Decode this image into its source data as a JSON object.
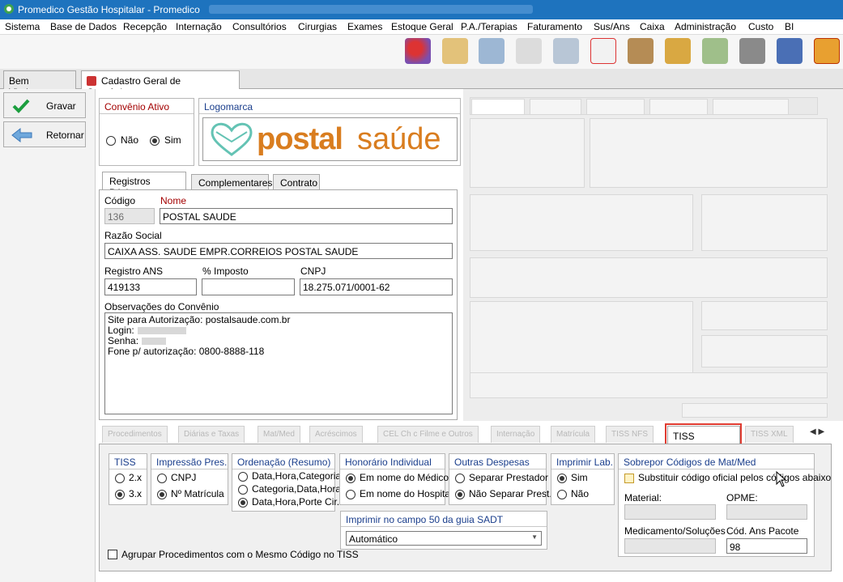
{
  "window": {
    "title": "Promedico Gestão Hospitalar - Promedico"
  },
  "menu": [
    "Sistema",
    "Base de Dados",
    "Recepção",
    "Internação",
    "Consultórios",
    "Cirurgias",
    "Exames",
    "Estoque Geral",
    "P.A./Terapias",
    "Faturamento",
    "Sus/Ans",
    "Caixa",
    "Administração",
    "Custo",
    "BI"
  ],
  "tabs": {
    "home": "Bem Vindo",
    "active": "Cadastro Geral de Convênios"
  },
  "actions": {
    "save": "Gravar",
    "back": "Retornar"
  },
  "convenio_ativo": {
    "caption": "Convênio Ativo",
    "no": "Não",
    "yes": "Sim"
  },
  "logo": {
    "caption": "Logomarca",
    "brand_part1": "postal",
    "brand_part2": "saúde"
  },
  "inner_tabs": [
    "Registros Básicos",
    "Complementares",
    "Contrato"
  ],
  "form": {
    "codigo_label": "Código",
    "codigo_value": "136",
    "nome_label": "Nome",
    "nome_value": "POSTAL SAUDE",
    "razao_label": "Razão Social",
    "razao_value": "CAIXA ASS. SAUDE EMPR.CORREIOS POSTAL SAUDE",
    "registro_label": "Registro ANS",
    "registro_value": "419133",
    "imposto_label": "% Imposto",
    "imposto_value": "",
    "cnpj_label": "CNPJ",
    "cnpj_value": "18.275.071/0001-62",
    "obs_label": "Observações do Convênio",
    "obs_lines": [
      "Site para Autorização: postalsaude.com.br",
      "Login:",
      "Senha:",
      "Fone p/ autorização: 0800-8888-118"
    ]
  },
  "bottom_tabs": {
    "active": "TISS Impressão"
  },
  "tiss": {
    "caption": "TISS",
    "opt1": "2.x",
    "opt2": "3.x"
  },
  "impressao": {
    "caption": "Impressão Pres.",
    "opt1": "CNPJ",
    "opt2": "Nº Matrícula"
  },
  "ordenacao": {
    "caption": "Ordenação (Resumo)",
    "opt1": "Data,Hora,Categoria",
    "opt2": "Categoria,Data,Hora",
    "opt3": "Data,Hora,Porte Cir."
  },
  "honorario": {
    "caption": "Honorário Individual",
    "opt1": "Em nome do Médico",
    "opt2": "Em nome do Hospital"
  },
  "outras": {
    "caption": "Outras Despesas",
    "opt1": "Separar Prestador",
    "opt2": "Não Separar Prest."
  },
  "imprimir_lab": {
    "caption": "Imprimir Lab.",
    "opt1": "Sim",
    "opt2": "Não"
  },
  "sobrepor": {
    "caption": "Sobrepor Códigos de Mat/Med",
    "check": "Substituir código oficial pelos códigos abaixo",
    "material": "Material:",
    "opme": "OPME:",
    "medicamento": "Medicamento/Soluções",
    "cod_ans": "Cód. Ans Pacote",
    "cod_ans_value": "98"
  },
  "sadt": {
    "caption": "Imprimir no campo 50 da guia SADT",
    "value": "Automático"
  },
  "agrupar": {
    "label": "Agrupar Procedimentos com o Mesmo Código no TISS"
  }
}
